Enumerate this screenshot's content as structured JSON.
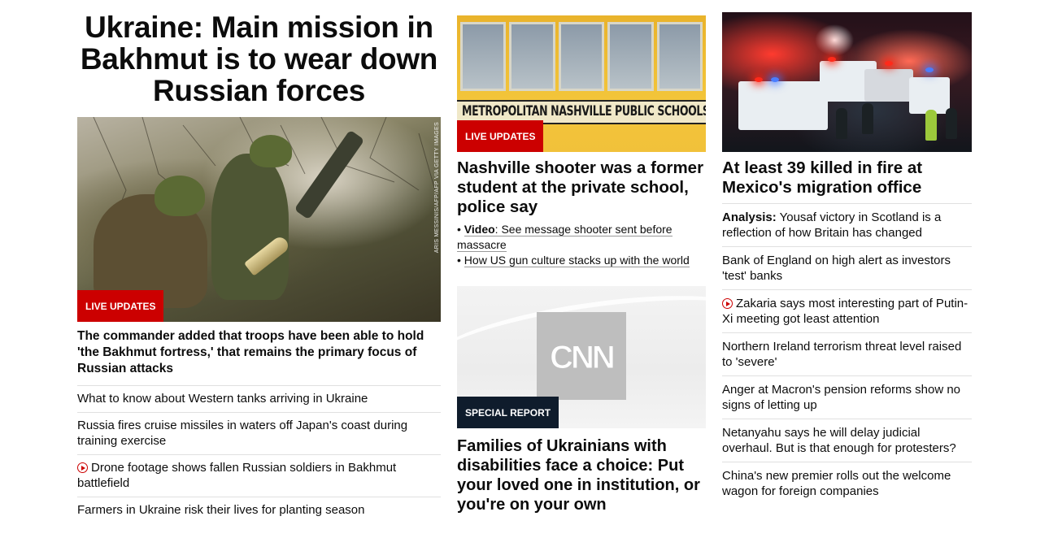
{
  "col1": {
    "headline": "Ukraine: Main mission in Bakhmut is to wear down Russian forces",
    "image_credit": "ARIS MESSINIS/AFP/AFP VIA GETTY IMAGES",
    "badge": "LIVE UPDATES",
    "summary": "The commander added that troops have been able to hold 'the Bakhmut fortress,' that remains the primary focus of Russian attacks",
    "links": [
      {
        "text": "What to know about Western tanks arriving in Ukraine",
        "video": false
      },
      {
        "text": "Russia fires cruise missiles in waters off Japan's coast during training exercise",
        "video": false
      },
      {
        "text": "Drone footage shows fallen Russian soldiers in Bakhmut battlefield",
        "video": true
      },
      {
        "text": "Farmers in Ukraine risk their lives for planting season",
        "video": false
      }
    ]
  },
  "col2": {
    "story1": {
      "image_text": "METROPOLITAN   NASHVILLE   PUBLIC   SCHOOLS",
      "badge": "LIVE UPDATES",
      "headline": "Nashville shooter was a former student at the private school, police say",
      "bullet1_prefix": "Video",
      "bullet1_text": ": See message shooter sent before massacre",
      "bullet2_text": "How US gun culture stacks up with the world"
    },
    "story2": {
      "logo": "CNN",
      "badge": "SPECIAL REPORT",
      "headline": "Families of Ukrainians with disabilities face a choice: Put your loved one in institution, or you're on your own"
    }
  },
  "col3": {
    "headline": "At least 39 killed in fire at Mexico's migration office",
    "links": [
      {
        "prefix": "Analysis:",
        "text": " Yousaf victory in Scotland is a reflection of how Britain has changed",
        "video": false
      },
      {
        "prefix": "",
        "text": "Bank of England on high alert as investors 'test' banks",
        "video": false
      },
      {
        "prefix": "",
        "text": "Zakaria says most interesting part of Putin-Xi meeting got least attention",
        "video": true
      },
      {
        "prefix": "",
        "text": "Northern Ireland terrorism threat level raised to 'severe'",
        "video": false
      },
      {
        "prefix": "",
        "text": "Anger at Macron's pension reforms show no signs of letting up",
        "video": false
      },
      {
        "prefix": "",
        "text": "Netanyahu says he will delay judicial overhaul. But is that enough for protesters?",
        "video": false
      },
      {
        "prefix": "",
        "text": "China's new premier rolls out the welcome wagon for foreign companies",
        "video": false
      }
    ]
  },
  "colors": {
    "live_badge": "#cc0000",
    "special_badge": "#0f1c2c",
    "divider": "#e0e0e0",
    "text": "#0c0c0c"
  }
}
